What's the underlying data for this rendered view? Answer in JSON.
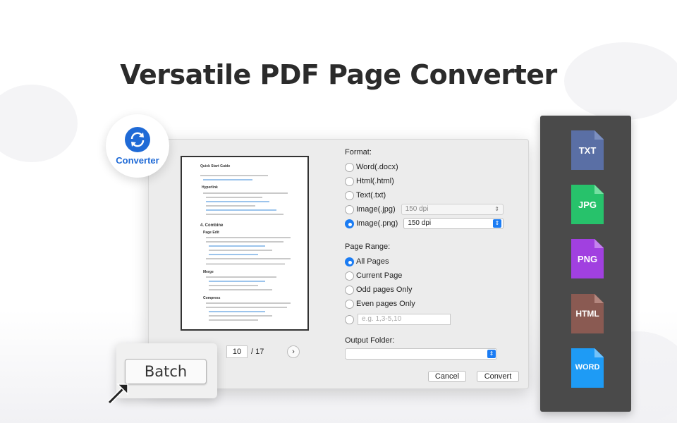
{
  "headline": "Versatile PDF Page Converter",
  "badge": {
    "label": "Converter",
    "icon": "sync-icon",
    "color": "#1f6ad6"
  },
  "preview": {
    "doc_title": "Quick Start Guide",
    "doc_section_1": "Hyperlink",
    "doc_section_2": "4. Combine",
    "doc_section_3": "Page Edit",
    "doc_section_4": "Merge",
    "doc_section_5": "Compress",
    "current_page": "10",
    "total_pages": "/ 17",
    "next_icon": "chevron-right-icon"
  },
  "format": {
    "label": "Format:",
    "options": [
      {
        "label": "Word(.docx)",
        "selected": false
      },
      {
        "label": "Html(.html)",
        "selected": false
      },
      {
        "label": "Text(.txt)",
        "selected": false
      },
      {
        "label": "Image(.jpg)",
        "selected": false,
        "dpi": "150 dpi"
      },
      {
        "label": "Image(.png)",
        "selected": true,
        "dpi": "150 dpi"
      }
    ]
  },
  "page_range": {
    "label": "Page Range:",
    "options": [
      {
        "label": "All Pages",
        "selected": true
      },
      {
        "label": "Current Page",
        "selected": false
      },
      {
        "label": "Odd pages Only",
        "selected": false
      },
      {
        "label": "Even pages Only",
        "selected": false
      }
    ],
    "custom_placeholder": "e.g. 1,3-5,10"
  },
  "output": {
    "label": "Output Folder:",
    "value": ""
  },
  "buttons": {
    "cancel": "Cancel",
    "convert": "Convert"
  },
  "batch": {
    "label": "Batch"
  },
  "formats_panel": [
    {
      "label": "TXT",
      "color": "#5a6fa5"
    },
    {
      "label": "JPG",
      "color": "#27c26b"
    },
    {
      "label": "PNG",
      "color": "#a140e0"
    },
    {
      "label": "HTML",
      "color": "#8a5a52"
    },
    {
      "label": "WORD",
      "color": "#1e9bf5"
    }
  ],
  "colors": {
    "accent": "#1b7cf3",
    "panel": "#4a4a4a"
  }
}
